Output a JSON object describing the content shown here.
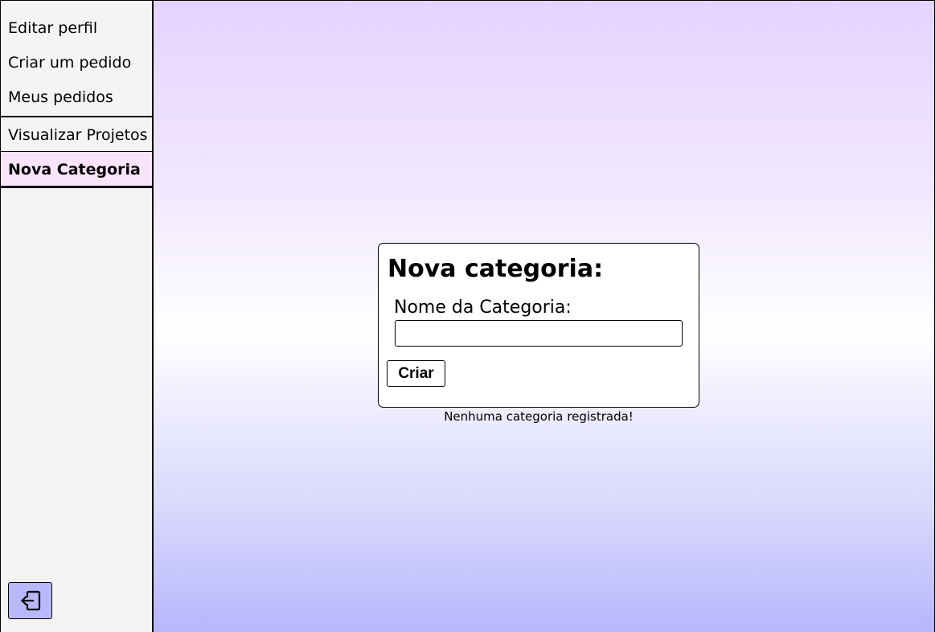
{
  "sidebar": {
    "items": [
      {
        "label": "Editar perfil"
      },
      {
        "label": "Criar um pedido"
      },
      {
        "label": "Meus pedidos"
      },
      {
        "label": "Visualizar Projetos"
      },
      {
        "label": "Nova Categoria"
      }
    ],
    "logout_icon": "logout-icon"
  },
  "card": {
    "title": "Nova categoria:",
    "field_label": "Nome da Categoria:",
    "input_value": "",
    "input_placeholder": "",
    "button_label": "Criar"
  },
  "status": {
    "empty_message": "Nenhuma categoria registrada!"
  },
  "colors": {
    "active_item": "#fae4fb",
    "logout_button": "#b9b8fb",
    "gradient_top": "#e5d4ff",
    "gradient_bottom": "#b7b6fc"
  }
}
